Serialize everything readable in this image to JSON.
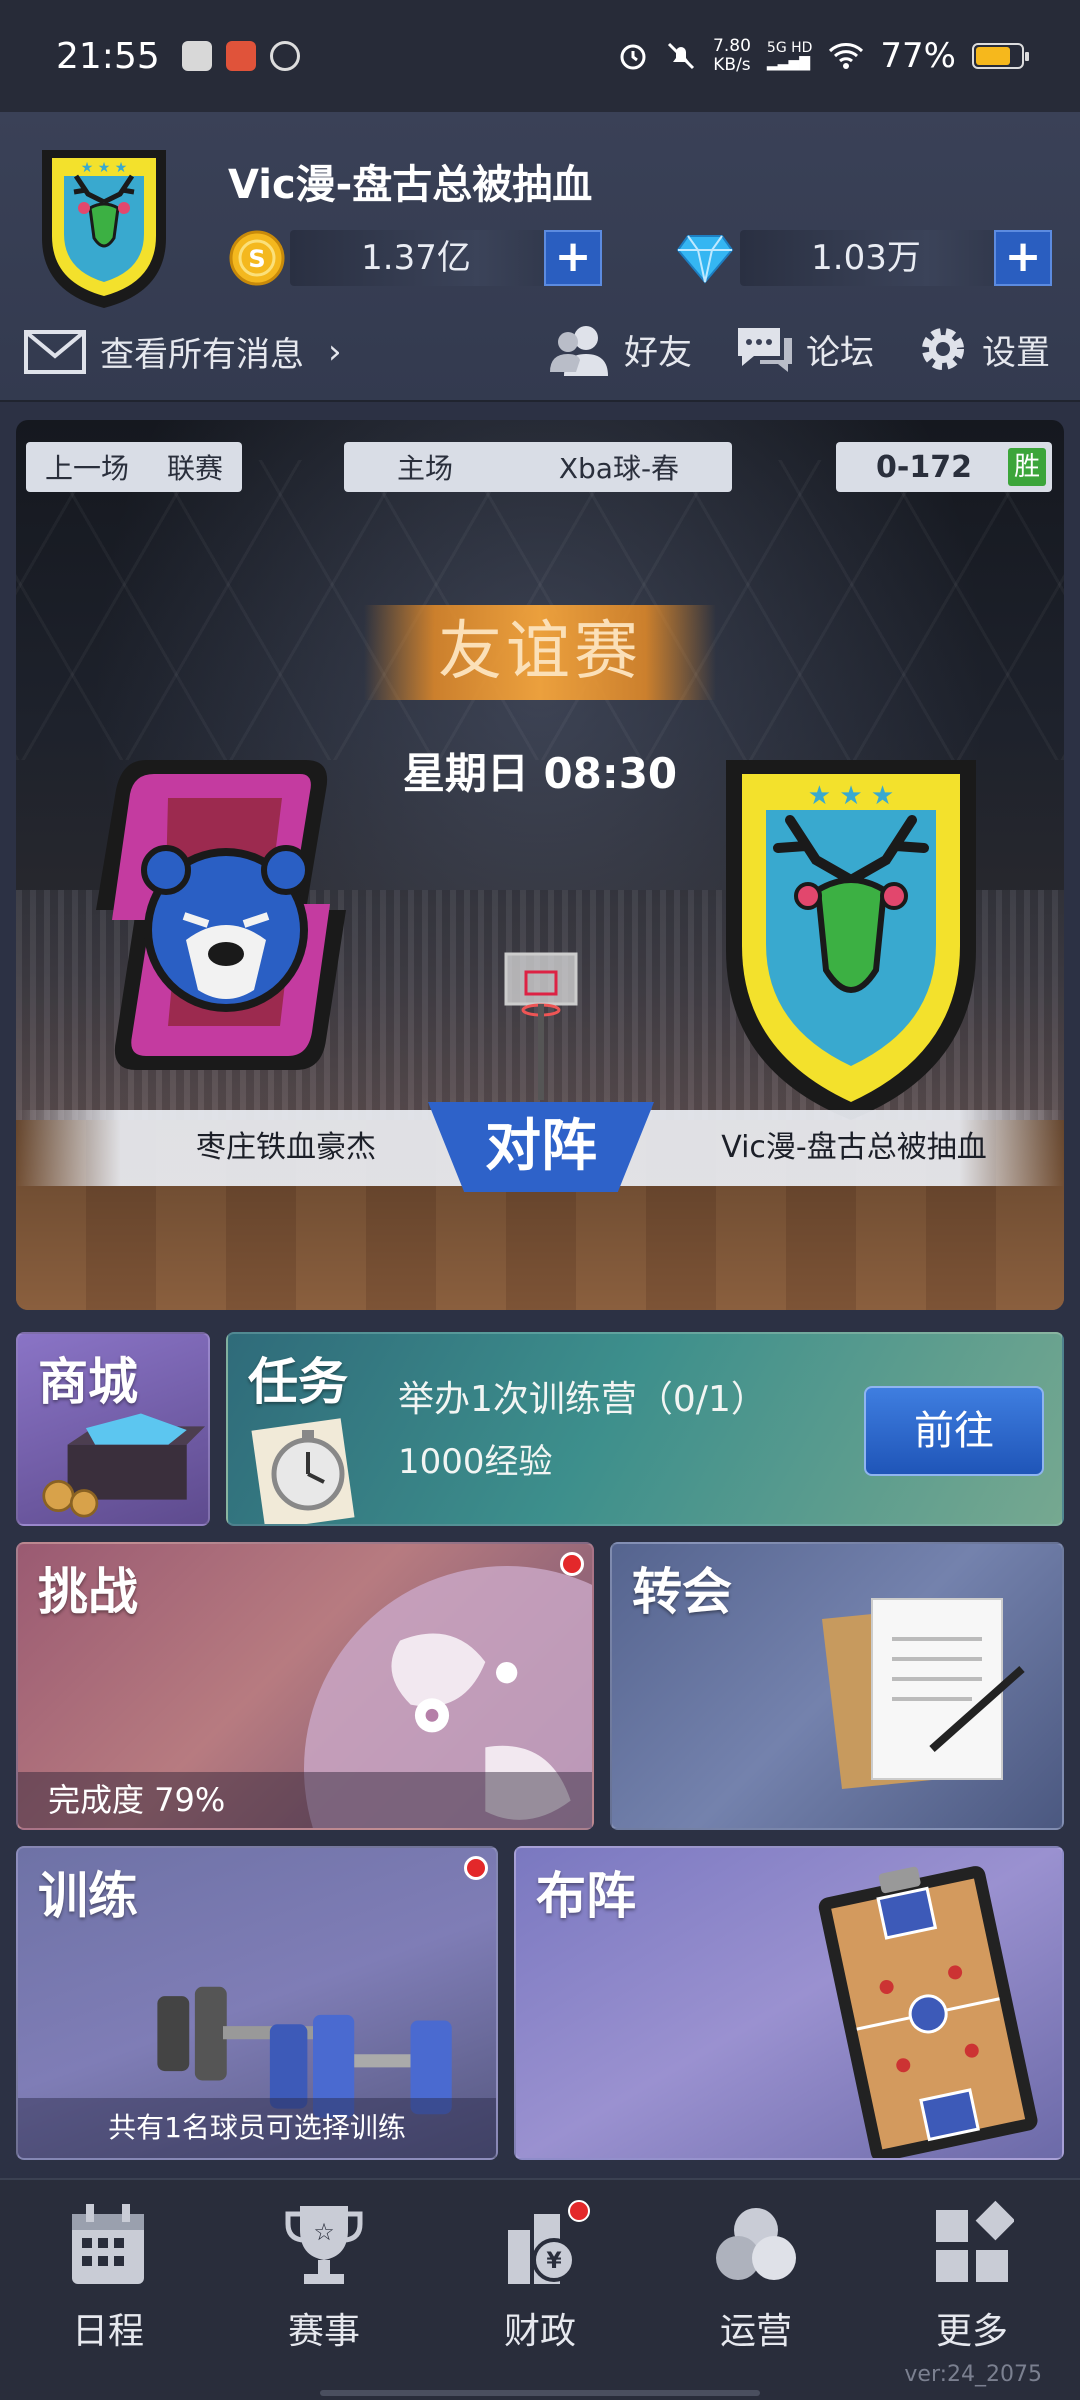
{
  "status_bar": {
    "time": "21:55",
    "net_speed_value": "7.80",
    "net_speed_unit": "KB/s",
    "signal_label": "5G HD",
    "battery": "77%",
    "battery_level": 0.77
  },
  "header": {
    "team_name": "Vic漫-盘古总被抽血",
    "coins": "1.37亿",
    "diamonds": "1.03万",
    "plus": "+",
    "messages_label": "查看所有消息",
    "messages_chevron": "›",
    "friends": "好友",
    "forum": "论坛",
    "settings": "设置"
  },
  "match": {
    "last_game": "上一场",
    "league": "联赛",
    "venue": "主场",
    "venue_name": "Xba球-春",
    "score": "0-172",
    "result": "胜",
    "type": "友谊赛",
    "time": "星期日 08:30",
    "home_team": "枣庄铁血豪杰",
    "versus": "对阵",
    "away_team": "Vic漫-盘古总被抽血"
  },
  "tiles": {
    "shop": "商城",
    "task_title": "任务",
    "task_desc": "举办1次训练营（0/1）",
    "task_reward": "1000经验",
    "task_go": "前往",
    "challenge": "挑战",
    "challenge_progress": "完成度 79%",
    "transfer": "转会",
    "training": "训练",
    "training_note": "共有1名球员可选择训练",
    "lineup": "布阵"
  },
  "bottom_nav": [
    {
      "label": "日程",
      "icon": "calendar-icon"
    },
    {
      "label": "赛事",
      "icon": "trophy-icon"
    },
    {
      "label": "财政",
      "icon": "finance-icon"
    },
    {
      "label": "运营",
      "icon": "operations-icon"
    },
    {
      "label": "更多",
      "icon": "more-icon"
    }
  ],
  "version": "ver:24_2075",
  "colors": {
    "accent_blue": "#2e62c9",
    "badge_red": "#e3282a",
    "win_green": "#3ca53a",
    "match_type_orange": "#f5a53c"
  }
}
